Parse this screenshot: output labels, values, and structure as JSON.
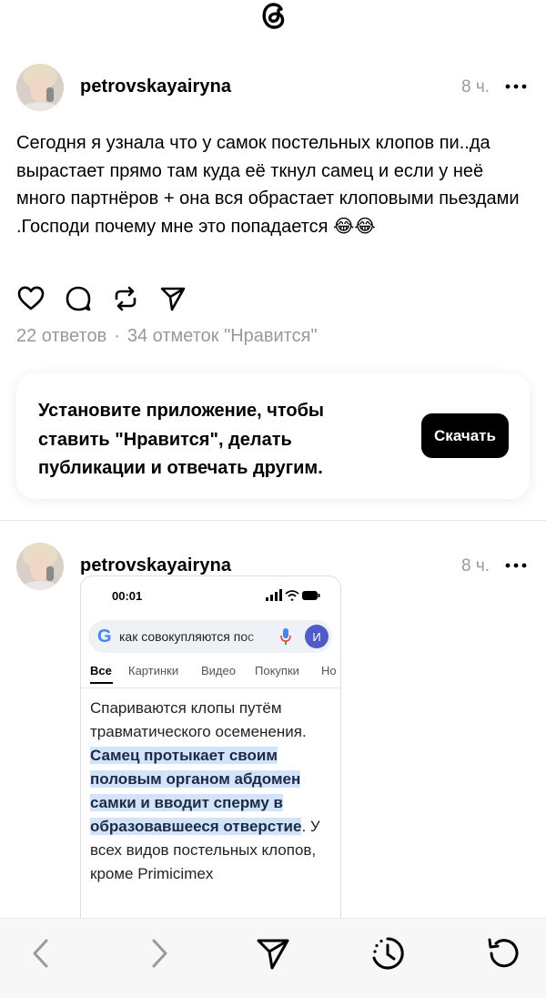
{
  "app": {
    "logo_icon": "threads-logo-icon"
  },
  "posts": [
    {
      "username": "petrovskayairyna",
      "time": "8 ч.",
      "text": "Сегодня я узнала что у самок постельных клопов пи..да вырастает прямо там куда её ткнул самец и если у неё много партнёров + она вся обрастает клоповыми пьездами .Господи почему мне это попадается 😂😂",
      "replies": "22 ответов",
      "separator": "·",
      "likes": "34 отметок \"Нравится\""
    },
    {
      "username": "petrovskayairyna",
      "time": "8 ч."
    }
  ],
  "cta": {
    "text": "Установите приложение, чтобы ставить \"Нравится\", делать публикации и отвечать другим.",
    "button": "Скачать"
  },
  "embed": {
    "time": "00:01",
    "query": "как совокупляются пос",
    "user_initial": "И",
    "tabs": [
      "Все",
      "Картинки",
      "Видео",
      "Покупки",
      "Но"
    ],
    "snippet_plain_1": "Спариваются клопы путём травматического осеменения. ",
    "snippet_highlight": "Самец протыкает своим половым органом абдомен самки и вводит сперму в образовавшееся отверстие",
    "snippet_plain_2": ". У всех видов постельных клопов, кроме Primicimex",
    "highlight_color": "#d2e3fc"
  },
  "bottom_nav": [
    "back-icon",
    "forward-icon",
    "share-icon",
    "history-icon",
    "reload-icon"
  ]
}
